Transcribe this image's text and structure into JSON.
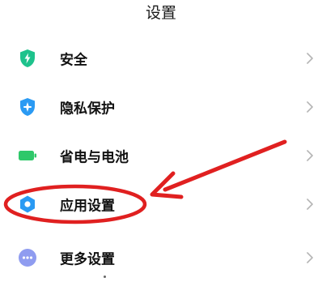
{
  "header": {
    "title": "设置"
  },
  "settings": {
    "items": [
      {
        "label": "安全",
        "icon": "shield-bolt-icon",
        "color": "#1ec28c"
      },
      {
        "label": "隐私保护",
        "icon": "privacy-shield-icon",
        "color": "#2a9af3"
      },
      {
        "label": "省电与电池",
        "icon": "battery-icon",
        "color": "#2fc86a"
      },
      {
        "label": "应用设置",
        "icon": "app-settings-gear-icon",
        "color": "#2a9af3"
      },
      {
        "label": "更多设置",
        "icon": "more-dots-icon",
        "color": "#8f9cf0"
      }
    ]
  },
  "annotation": {
    "color": "#e02020",
    "highlighted_item": "应用设置"
  },
  "theme": {
    "chevron_color": "#b4b4b4",
    "text_color": "#111111"
  }
}
